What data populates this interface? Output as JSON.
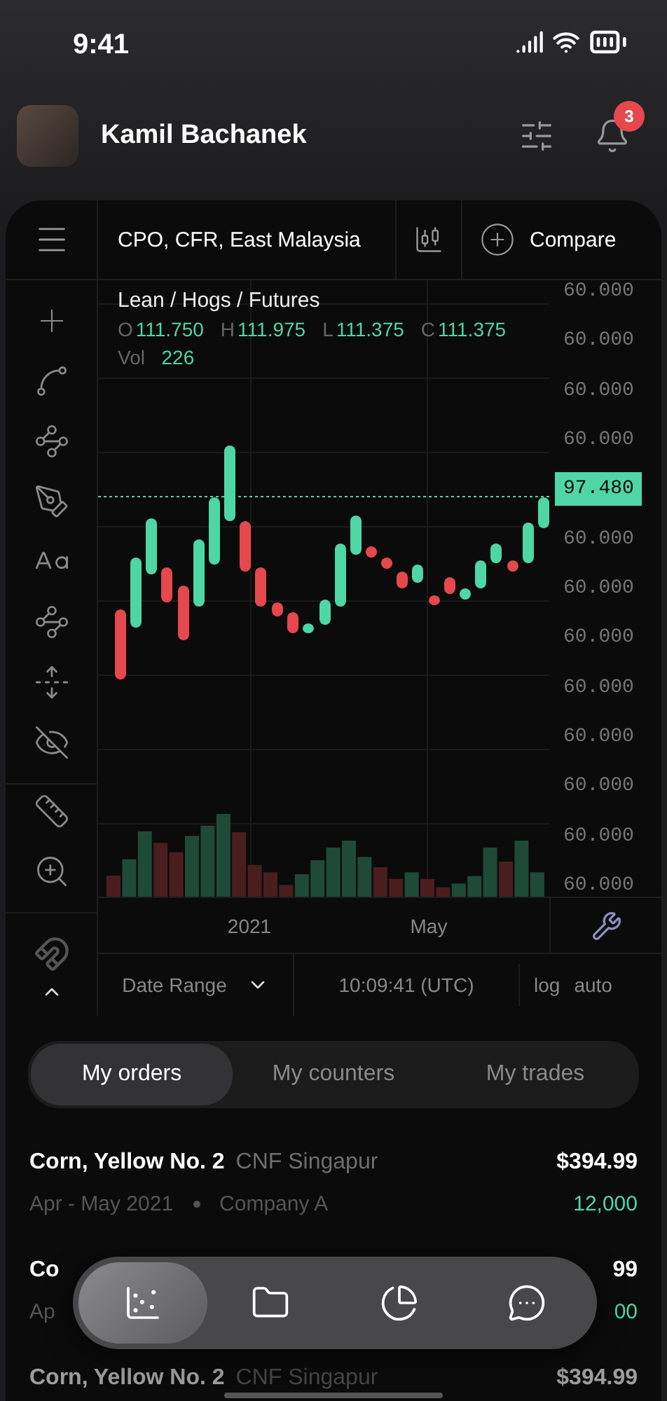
{
  "status_bar": {
    "time": "9:41"
  },
  "header": {
    "user_name": "Kamil Bachanek",
    "notification_count": "3"
  },
  "chart_panel": {
    "instrument": "CPO, CFR, East Malaysia",
    "compare": "Compare",
    "legend": {
      "title": "Lean / Hogs / Futures",
      "ohlc": [
        {
          "key": "O",
          "value": "111.750"
        },
        {
          "key": "H",
          "value": "111.975"
        },
        {
          "key": "L",
          "value": "111.375"
        },
        {
          "key": "C",
          "value": "111.375"
        }
      ],
      "volume_label": "Vol",
      "volume": "226"
    },
    "price_axis": [
      {
        "kind": "tick",
        "label": "60.000"
      },
      {
        "kind": "tick",
        "label": "60.000"
      },
      {
        "kind": "tick",
        "label": "60.000"
      },
      {
        "kind": "tick",
        "label": "60.000"
      },
      {
        "kind": "current",
        "label": "97.480"
      },
      {
        "kind": "tick",
        "label": "60.000"
      },
      {
        "kind": "tick",
        "label": "60.000"
      },
      {
        "kind": "tick",
        "label": "60.000"
      },
      {
        "kind": "tick",
        "label": "60.000"
      },
      {
        "kind": "tick",
        "label": "60.000"
      },
      {
        "kind": "tick",
        "label": "60.000"
      },
      {
        "kind": "tick",
        "label": "60.000"
      },
      {
        "kind": "tick",
        "label": "60.000"
      }
    ],
    "time_axis": [
      "2021",
      "May"
    ],
    "footer": {
      "date_range": "Date Range",
      "time": "10:09:41 (UTC)",
      "scale_options": [
        "log",
        "auto"
      ]
    }
  },
  "tabs": [
    {
      "label": "My orders",
      "selected": true
    },
    {
      "label": "My counters",
      "selected": false
    },
    {
      "label": "My trades",
      "selected": false
    }
  ],
  "orders": [
    {
      "name": "Corn, Yellow No. 2",
      "market": "CNF Singapur",
      "period": "Apr - May 2021",
      "company": "Company A",
      "price": "$394.99",
      "quantity": "12,000"
    },
    {
      "name": "Co",
      "period": "Ap",
      "price": "99",
      "quantity": "00"
    },
    {
      "name": "Corn, Yellow No. 2",
      "market": "CNF Singapur",
      "price": "$394.99"
    }
  ],
  "bottom_nav": [
    {
      "selected": true
    },
    {
      "selected": false
    },
    {
      "selected": false
    },
    {
      "selected": false
    }
  ]
}
